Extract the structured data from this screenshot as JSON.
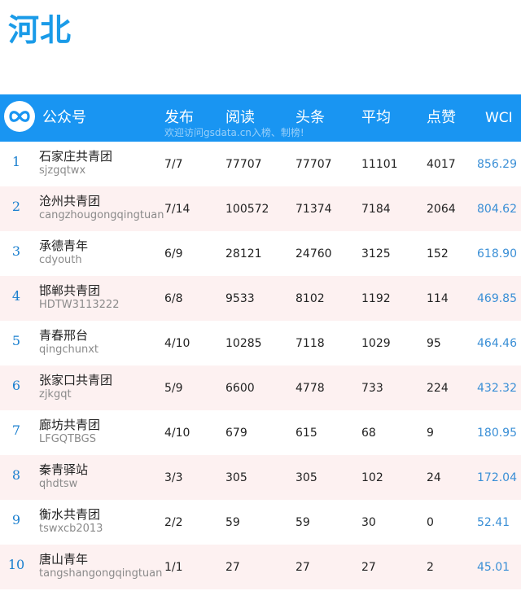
{
  "page_title": "河北",
  "header": {
    "logo_icon": "infinity-logo-icon",
    "account_label": "公众号",
    "col_publish": "发布",
    "col_read": "阅读",
    "col_headline": "头条",
    "col_average": "平均",
    "col_likes": "点赞",
    "col_wci": "WCI",
    "watermark": "欢迎访问gsdata.cn入榜、制榜!"
  },
  "colors": {
    "header_bg": "#1995f2",
    "title": "#1a9be8",
    "wci": "#3a8fd6",
    "alt_row": "#fdf1f1"
  },
  "rows": [
    {
      "rank": "1",
      "name": "石家庄共青团",
      "account": "sjzgqtwx",
      "publish": "7/7",
      "read": "77707",
      "headline": "77707",
      "average": "11101",
      "likes": "4017",
      "wci": "856.29"
    },
    {
      "rank": "2",
      "name": "沧州共青团",
      "account": "cangzhougongqingtuan",
      "publish": "7/14",
      "read": "100572",
      "headline": "71374",
      "average": "7184",
      "likes": "2064",
      "wci": "804.62"
    },
    {
      "rank": "3",
      "name": "承德青年",
      "account": "cdyouth",
      "publish": "6/9",
      "read": "28121",
      "headline": "24760",
      "average": "3125",
      "likes": "152",
      "wci": "618.90"
    },
    {
      "rank": "4",
      "name": "邯郸共青团",
      "account": "HDTW3113222",
      "publish": "6/8",
      "read": "9533",
      "headline": "8102",
      "average": "1192",
      "likes": "114",
      "wci": "469.85"
    },
    {
      "rank": "5",
      "name": "青春邢台",
      "account": "qingchunxt",
      "publish": "4/10",
      "read": "10285",
      "headline": "7118",
      "average": "1029",
      "likes": "95",
      "wci": "464.46"
    },
    {
      "rank": "6",
      "name": "张家口共青团",
      "account": "zjkgqt",
      "publish": "5/9",
      "read": "6600",
      "headline": "4778",
      "average": "733",
      "likes": "224",
      "wci": "432.32"
    },
    {
      "rank": "7",
      "name": "廊坊共青团",
      "account": "LFGQTBGS",
      "publish": "4/10",
      "read": "679",
      "headline": "615",
      "average": "68",
      "likes": "9",
      "wci": "180.95"
    },
    {
      "rank": "8",
      "name": "秦青驿站",
      "account": "qhdtsw",
      "publish": "3/3",
      "read": "305",
      "headline": "305",
      "average": "102",
      "likes": "24",
      "wci": "172.04"
    },
    {
      "rank": "9",
      "name": "衡水共青团",
      "account": "tswxcb2013",
      "publish": "2/2",
      "read": "59",
      "headline": "59",
      "average": "30",
      "likes": "0",
      "wci": "52.41"
    },
    {
      "rank": "10",
      "name": "唐山青年",
      "account": "tangshangongqingtuan",
      "publish": "1/1",
      "read": "27",
      "headline": "27",
      "average": "27",
      "likes": "2",
      "wci": "45.01"
    }
  ]
}
